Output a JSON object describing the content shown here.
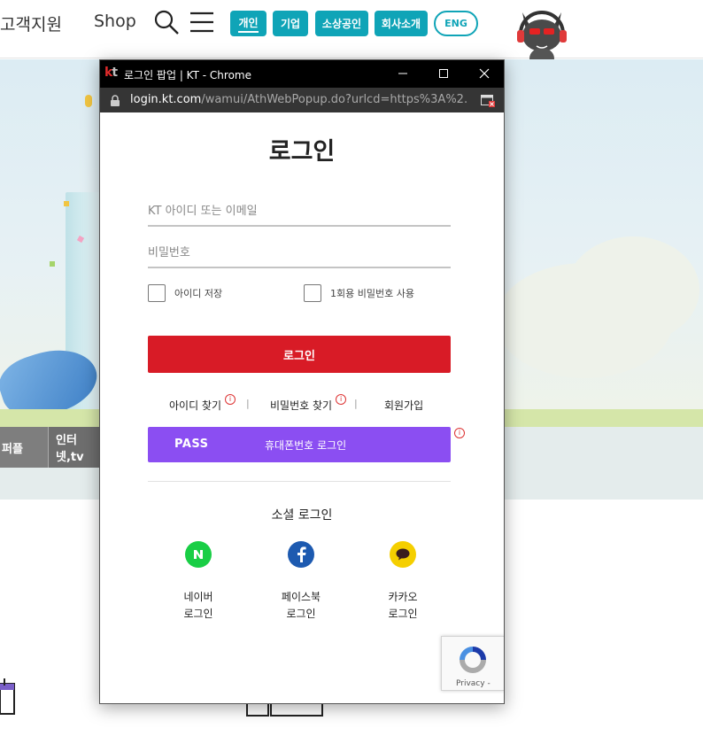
{
  "site": {
    "nav_support": "고객지원",
    "nav_shop": "Shop",
    "segments": {
      "personal": "개인",
      "business": "기업",
      "small_business": "소상공인",
      "company": "회사소개",
      "english": "ENG"
    },
    "hero_tabs": [
      "퍼플",
      "인터넷,tv"
    ]
  },
  "window": {
    "title": "로그인 팝업 | KT - Chrome",
    "url_host": "login.kt.com",
    "url_path": "/wamui/AthWebPopup.do?urlcd=https%3A%2..."
  },
  "login": {
    "title": "로그인",
    "id_placeholder": "KT 아이디 또는 이메일",
    "pw_placeholder": "비밀번호",
    "save_id_label": "아이디 저장",
    "otp_label": "1회용 비밀번호 사용",
    "login_button": "로그인",
    "find_id": "아이디 찾기",
    "find_pw": "비밀번호 찾기",
    "join": "회원가입",
    "pass_brand": "PASS",
    "pass_label": "휴대폰번호 로그인",
    "social_title": "소셜 로그인",
    "social": {
      "naver_line1": "네이버",
      "naver_line2": "로그인",
      "facebook_line1": "페이스북",
      "facebook_line2": "로그인",
      "kakao_line1": "카카오",
      "kakao_line2": "로그인"
    },
    "recaptcha": "Privacy -"
  },
  "colors": {
    "kt_teal": "#0fa4b7",
    "login_red": "#d81b26",
    "pass_purple": "#8b4ef2",
    "naver_green": "#19ce45",
    "facebook_blue": "#1d5ab0",
    "kakao_yellow": "#f5cf00"
  },
  "icons": [
    "search-icon",
    "menu-icon",
    "mascot-icon",
    "lock-icon",
    "popup-blocked-icon",
    "info-icon",
    "naver-icon",
    "facebook-icon",
    "kakao-icon",
    "recaptcha-icon",
    "calendar-icon"
  ]
}
